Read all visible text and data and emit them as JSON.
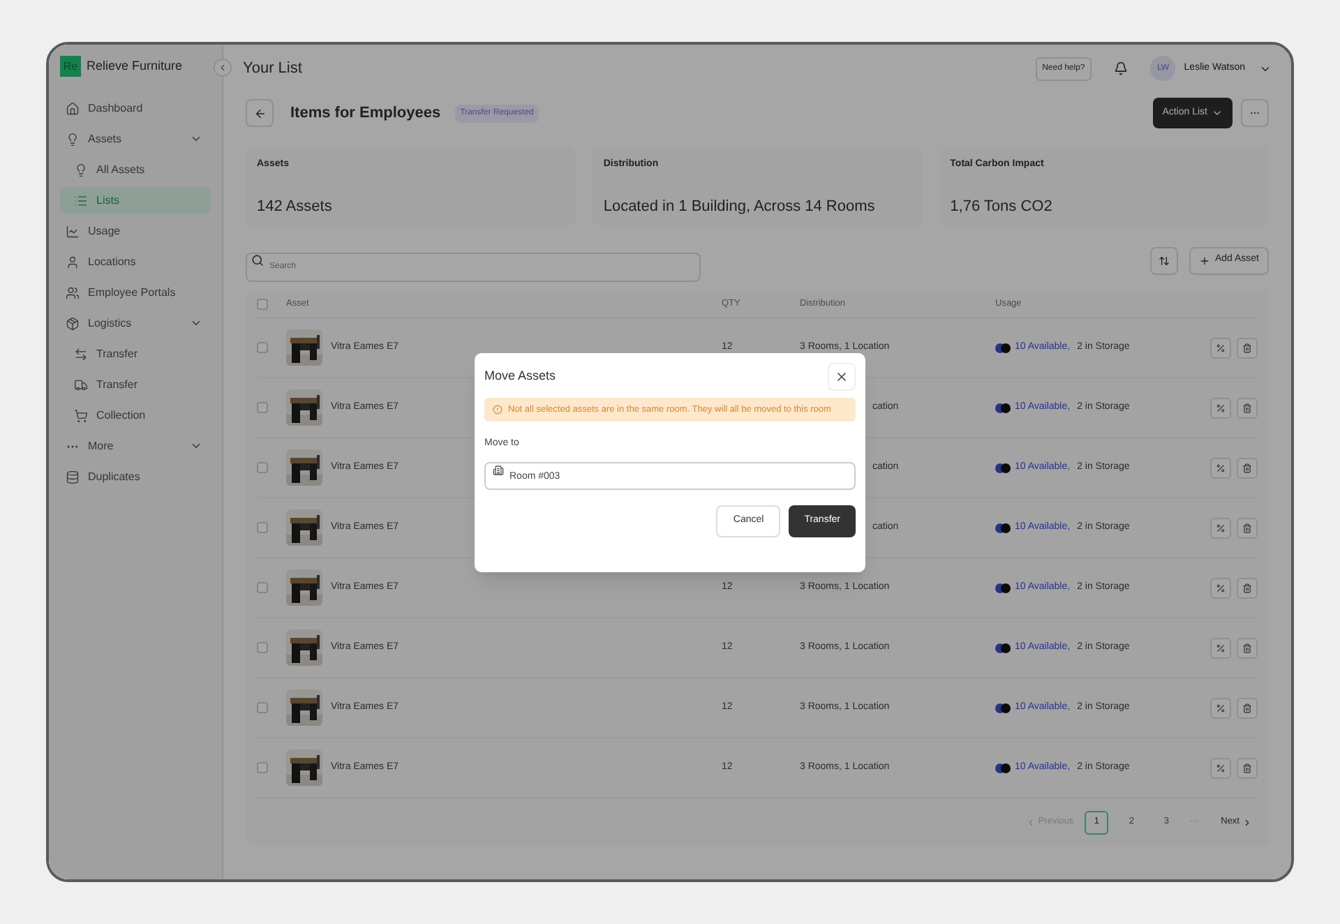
{
  "sidebar": {
    "brand": {
      "logo": "Re",
      "name": "Relieve Furniture"
    },
    "items": [
      {
        "label": "Dashboard",
        "selected": false
      },
      {
        "label": "Assets",
        "selected": false,
        "expanded": true,
        "children": [
          {
            "label": "All Assets",
            "selected": false
          },
          {
            "label": "Lists",
            "selected": true
          }
        ]
      },
      {
        "label": "Usage",
        "selected": false
      },
      {
        "label": "Locations",
        "selected": false
      },
      {
        "label": "Employee Portals",
        "selected": false
      },
      {
        "label": "Logistics",
        "selected": false,
        "expanded": true,
        "children": [
          {
            "label": "Transfer",
            "selected": false
          },
          {
            "label": "Transfer",
            "selected": false
          },
          {
            "label": "Collection",
            "selected": false
          }
        ]
      },
      {
        "label": "More",
        "selected": false,
        "expanded": true
      },
      {
        "label": "Duplicates",
        "selected": false
      }
    ]
  },
  "topbar": {
    "title": "Your List",
    "help": "Need help?",
    "user": {
      "initials": "LW",
      "name": "Leslie Watson"
    }
  },
  "header": {
    "title": "Items for Employees",
    "badge": "Transfer Requested",
    "action": "Action List"
  },
  "cards": [
    {
      "label": "Assets",
      "value": "142 Assets"
    },
    {
      "label": "Distribution",
      "value": "Located in 1 Building, Across 14 Rooms"
    },
    {
      "label": "Total Carbon Impact",
      "value": "1,76 Tons CO2"
    }
  ],
  "search": {
    "placeholder": "Search"
  },
  "add_button": "Add Asset",
  "table": {
    "select_all": {
      "checked": false
    },
    "columns": [
      "Asset",
      "QTY",
      "Distribution",
      "Usage"
    ],
    "rows": [
      {
        "checked": false,
        "name": "Vitra Eames E7",
        "qty": "12",
        "distribution": "3 Rooms, 1 Location",
        "available": "10 Available,",
        "storage": "2 in Storage"
      },
      {
        "checked": false,
        "name": "Vitra Eames E7",
        "distribution": "cation",
        "available": "10 Available,",
        "storage": "2 in Storage"
      },
      {
        "checked": false,
        "name": "Vitra Eames E7",
        "distribution": "cation",
        "available": "10 Available,",
        "storage": "2 in Storage"
      },
      {
        "checked": false,
        "name": "Vitra Eames E7",
        "distribution": "cation",
        "available": "10 Available,",
        "storage": "2 in Storage"
      },
      {
        "checked": false,
        "name": "Vitra Eames E7",
        "qty": "12",
        "distribution": "3 Rooms, 1 Location",
        "available": "10 Available,",
        "storage": "2 in Storage"
      },
      {
        "checked": false,
        "name": "Vitra Eames E7",
        "qty": "12",
        "distribution": "3 Rooms, 1 Location",
        "available": "10 Available,",
        "storage": "2 in Storage"
      },
      {
        "checked": false,
        "name": "Vitra Eames E7",
        "qty": "12",
        "distribution": "3 Rooms, 1 Location",
        "available": "10 Available,",
        "storage": "2 in Storage"
      },
      {
        "checked": false,
        "name": "Vitra Eames E7",
        "qty": "12",
        "distribution": "3 Rooms, 1 Location",
        "available": "10 Available,",
        "storage": "2 in Storage"
      }
    ]
  },
  "pagination": {
    "previous": {
      "label": "Previous",
      "disabled": true
    },
    "pages": [
      {
        "label": "1",
        "selected": true
      },
      {
        "label": "2",
        "selected": false
      },
      {
        "label": "3",
        "selected": false
      }
    ],
    "ellipsis": "···",
    "next": {
      "label": "Next",
      "disabled": false
    }
  },
  "dialog": {
    "title": "Move Assets",
    "warning": "Not all selected assets are in the same room. They will all be moved to this room",
    "field_label": "Move to",
    "field_value": "Room #003",
    "buttons": [
      {
        "label": "Cancel",
        "kind": "secondary"
      },
      {
        "label": "Transfer",
        "kind": "primary"
      }
    ]
  }
}
